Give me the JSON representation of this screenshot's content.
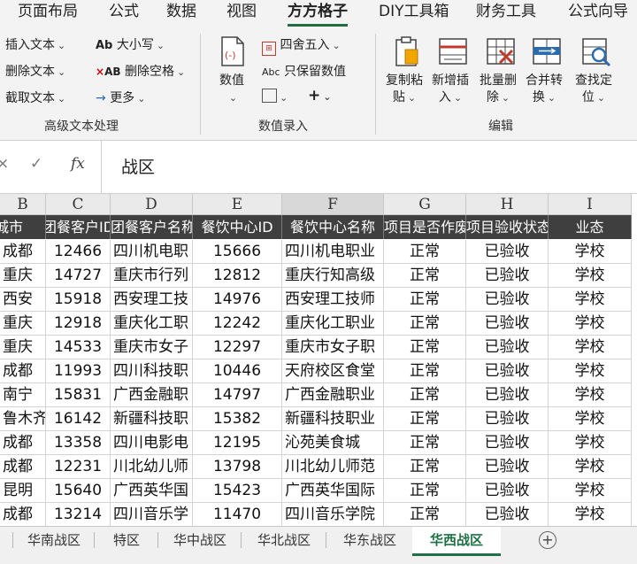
{
  "ribbon_tabs": [
    "页面布局",
    "公式",
    "数据",
    "视图",
    "方方格子",
    "DIY工具箱",
    "财务工具",
    "公式向导"
  ],
  "active_tab_index": 4,
  "ribbon": {
    "text_group": {
      "insert_text": "插入文本",
      "delete_text": "删除文本",
      "extract_text": "截取文本",
      "case": "大小写",
      "delete_spaces": "删除空格",
      "more": "更多",
      "label": "高级文本处理"
    },
    "value_group": {
      "value_button": "数值",
      "round": "四舍五入",
      "keep_values": "只保留数值",
      "label": "数值录入"
    },
    "edit_group": {
      "copy_paste": [
        "复制粘",
        "贴"
      ],
      "add_insert": [
        "新增插",
        "入"
      ],
      "batch_delete": [
        "批量删",
        "除"
      ],
      "merge_convert": [
        "合并转",
        "换"
      ],
      "find_locate": [
        "查找定",
        "位"
      ],
      "label": "编辑"
    }
  },
  "formula_bar": {
    "fx": "fx",
    "value": "战区"
  },
  "columns": [
    "B",
    "C",
    "D",
    "E",
    "F",
    "G",
    "H",
    "I"
  ],
  "selected_column": "F",
  "table": {
    "headers": [
      "城市",
      "团餐客户ID",
      "团餐客户名称",
      "餐饮中心ID",
      "餐饮中心名称",
      "项目是否作废",
      "项目验收状态",
      "业态"
    ],
    "rows": [
      [
        "成都",
        "12466",
        "四川机电职",
        "15666",
        "四川机电职业",
        "正常",
        "已验收",
        "学校"
      ],
      [
        "重庆",
        "14727",
        "重庆市行列",
        "12812",
        "重庆行知高级",
        "正常",
        "已验收",
        "学校"
      ],
      [
        "西安",
        "15918",
        "西安理工技",
        "14976",
        "西安理工技师",
        "正常",
        "已验收",
        "学校"
      ],
      [
        "重庆",
        "12918",
        "重庆化工职",
        "12242",
        "重庆化工职业",
        "正常",
        "已验收",
        "学校"
      ],
      [
        "重庆",
        "14533",
        "重庆市女子",
        "12297",
        "重庆市女子职",
        "正常",
        "已验收",
        "学校"
      ],
      [
        "成都",
        "11993",
        "四川科技职",
        "10446",
        "天府校区食堂",
        "正常",
        "已验收",
        "学校"
      ],
      [
        "南宁",
        "15831",
        "广西金融职",
        "14797",
        "广西金融职业",
        "正常",
        "已验收",
        "学校"
      ],
      [
        "鲁木齐",
        "16142",
        "新疆科技职",
        "15382",
        "新疆科技职业",
        "正常",
        "已验收",
        "学校"
      ],
      [
        "成都",
        "13358",
        "四川电影电",
        "12195",
        "沁苑美食城",
        "正常",
        "已验收",
        "学校"
      ],
      [
        "成都",
        "12231",
        "川北幼儿师",
        "13798",
        "川北幼儿师范",
        "正常",
        "已验收",
        "学校"
      ],
      [
        "昆明",
        "15640",
        "广西英华国",
        "15423",
        "广西英华国际",
        "正常",
        "已验收",
        "学校"
      ],
      [
        "成都",
        "13214",
        "四川音乐学",
        "11470",
        "四川音乐学院",
        "正常",
        "已验收",
        "学校"
      ]
    ]
  },
  "sheet_tabs": [
    "华南战区",
    "特区",
    "华中战区",
    "华北战区",
    "华东战区",
    "华西战区"
  ],
  "active_sheet_index": 5,
  "colors": {
    "header_dark": "#3f3f3f",
    "accent_green": "#1e7145",
    "ribbon_bg": "#f3f3f3"
  }
}
